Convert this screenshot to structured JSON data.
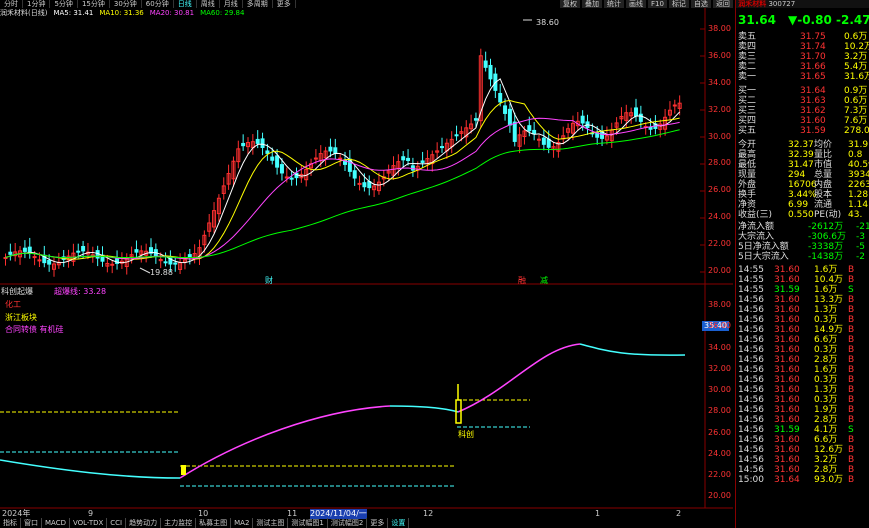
{
  "periods": [
    "分时",
    "1分钟",
    "5分钟",
    "15分钟",
    "30分钟",
    "60分钟",
    "日线",
    "周线",
    "月线",
    "多周期",
    "更多"
  ],
  "active_period": "日线",
  "top_right_buttons": [
    "复权",
    "叠加",
    "统计",
    "画线",
    "F10",
    "标记",
    "自选",
    "返回"
  ],
  "info": {
    "name": "润禾材料(日线)",
    "ma5": "MA5: 31.41",
    "ma10": "MA10: 31.36",
    "ma20": "MA20: 30.81",
    "ma60": "MA60: 29.84"
  },
  "colors": {
    "ma5": "#ffffff",
    "ma10": "#ffff00",
    "ma20": "#ff44ff",
    "ma60": "#00ff00",
    "up": "#ff3030",
    "down": "#44ffff"
  },
  "price_axis": [
    "30.00",
    "28.00",
    "26.00",
    "24.00",
    "22.00",
    "20.00",
    "32.00",
    "34.00",
    "36.00",
    "38.00"
  ],
  "sub_axis": [
    "38.00",
    "36.00",
    "34.00",
    "32.00",
    "30.00",
    "28.00",
    "26.00",
    "24.00",
    "22.00",
    "20.00"
  ],
  "markers": {
    "high": "38.60",
    "low": "19.88",
    "cai": "财",
    "ma": "融",
    "fa": "减"
  },
  "sub": {
    "title": "科创起爆",
    "indicator": "超爆线: 33.28",
    "legend1": "化工",
    "legend2": "浙江板块",
    "legend3": "合同转债 有机硅",
    "badge": "35.40",
    "tag": "科创"
  },
  "dates": [
    "2024年",
    "9",
    "10",
    "11",
    "2024/11/04/一",
    "12",
    "1",
    "2"
  ],
  "tabs": [
    "指标",
    "窗口",
    "MACD",
    "VOL-TDX",
    "CCI",
    "趋势动力",
    "主力监控",
    "私募主图",
    "MA2",
    "测试主图",
    "测试幅图1",
    "测试幅图2",
    "更多",
    "设置"
  ],
  "active_tab": "设置",
  "stock": {
    "title": "润禾材料",
    "code": "300727",
    "price": "31.64",
    "change": "▼-0.80",
    "pct": "-2.47%"
  },
  "asks": [
    [
      "卖五",
      "¥",
      "31.75",
      "0.6万"
    ],
    [
      "卖四",
      "",
      "31.74",
      "10.2万"
    ],
    [
      "卖三",
      "",
      "31.70",
      "3.2万"
    ],
    [
      "卖二",
      "",
      "31.66",
      "5.4万"
    ],
    [
      "卖一",
      "",
      "31.65",
      "31.6万"
    ]
  ],
  "bids": [
    [
      "买一",
      "",
      "31.64",
      "0.9万"
    ],
    [
      "买二",
      "",
      "31.63",
      "0.6万"
    ],
    [
      "买三",
      "",
      "31.62",
      "7.3万"
    ],
    [
      "买四",
      "",
      "31.60",
      "7.6万"
    ],
    [
      "买五",
      "",
      "31.59",
      "278.0万"
    ]
  ],
  "stats": [
    [
      "今开",
      "32.37",
      "均价",
      "31.9"
    ],
    [
      "最高",
      "32.39",
      "量比",
      "0.8"
    ],
    [
      "最低",
      "31.47",
      "市值",
      "40.5亿"
    ],
    [
      "现量",
      "294",
      "总量",
      "3934"
    ],
    [
      "外盘",
      "16706",
      "内盘",
      "2263"
    ],
    [
      "换手",
      "3.44%",
      "股本",
      "1.28"
    ],
    [
      "净资",
      "6.99",
      "流通",
      "1.14"
    ],
    [
      "收益(三)",
      "0.550",
      "PE(动)",
      "43."
    ]
  ],
  "flows": [
    [
      "净流入额",
      "-2612万",
      "-21"
    ],
    [
      "大宗流入",
      "-306.6万",
      "-3"
    ],
    [
      "5日净流入额",
      "-3338万",
      "-5"
    ],
    [
      "5日大宗流入",
      "-1438万",
      "-2"
    ]
  ],
  "ticks": [
    [
      "14:55",
      "31.60",
      "1.6万",
      "B"
    ],
    [
      "14:55",
      "31.60",
      "10.4万",
      "B"
    ],
    [
      "14:55",
      "31.59",
      "1.6万",
      "S"
    ],
    [
      "14:56",
      "31.60",
      "13.3万",
      "B"
    ],
    [
      "14:56",
      "31.60",
      "1.3万",
      "B"
    ],
    [
      "14:56",
      "31.60",
      "0.3万",
      "B"
    ],
    [
      "14:56",
      "31.60",
      "14.9万",
      "B"
    ],
    [
      "14:56",
      "31.60",
      "6.6万",
      "B"
    ],
    [
      "14:56",
      "31.60",
      "0.3万",
      "B"
    ],
    [
      "14:56",
      "31.60",
      "2.8万",
      "B"
    ],
    [
      "14:56",
      "31.60",
      "1.6万",
      "B"
    ],
    [
      "14:56",
      "31.60",
      "0.3万",
      "B"
    ],
    [
      "14:56",
      "31.60",
      "1.3万",
      "B"
    ],
    [
      "14:56",
      "31.60",
      "0.3万",
      "B"
    ],
    [
      "14:56",
      "31.60",
      "1.9万",
      "B"
    ],
    [
      "14:56",
      "31.60",
      "2.8万",
      "B"
    ],
    [
      "14:56",
      "31.59",
      "4.1万",
      "S"
    ],
    [
      "14:56",
      "31.60",
      "6.6万",
      "B"
    ],
    [
      "14:56",
      "31.60",
      "12.6万",
      "B"
    ],
    [
      "14:56",
      "31.60",
      "3.2万",
      "B"
    ],
    [
      "14:56",
      "31.60",
      "2.8万",
      "B"
    ],
    [
      "15:00",
      "31.64",
      "93.0万",
      "B"
    ]
  ],
  "right_tabs": [
    "日线"
  ]
}
